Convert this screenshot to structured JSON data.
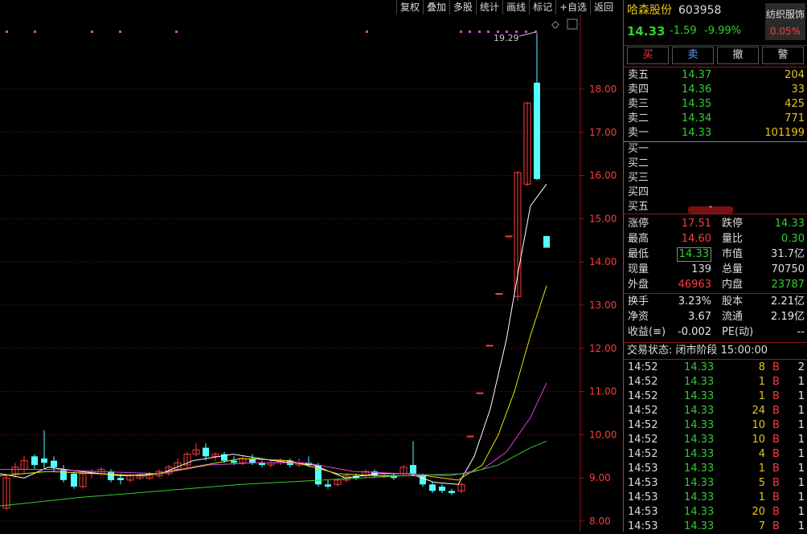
{
  "toolbar": {
    "items": [
      "复权",
      "叠加",
      "多股",
      "统计",
      "画线",
      "标记",
      "+自选",
      "返回"
    ]
  },
  "chart": {
    "price_ticks": [
      "18.00",
      "17.00",
      "16.00",
      "15.00",
      "14.00",
      "13.00",
      "12.00",
      "11.00",
      "10.00",
      "9.00",
      "8.00"
    ],
    "price_values": [
      18,
      17,
      16,
      15,
      14,
      13,
      12,
      11,
      10,
      9,
      8
    ],
    "high_label": "19.29",
    "colors": {
      "up": "#ff3b3b",
      "down": "#54ffff",
      "ma5": "#ffffff",
      "ma10": "#e6e600",
      "ma20": "#e040e0",
      "ma60": "#32cd32",
      "grid": "#8b1a1a"
    }
  },
  "stock": {
    "name": "哈森股份",
    "code": "603958",
    "price": "14.33",
    "change": "-1.59",
    "pct": "-9.99%",
    "sector": "纺织服饰",
    "sector_pct": "0.05%"
  },
  "trade_buttons": [
    "买",
    "卖",
    "撤",
    "警"
  ],
  "sell_orders": [
    {
      "label": "卖五",
      "price": "14.37",
      "vol": "204"
    },
    {
      "label": "卖四",
      "price": "14.36",
      "vol": "33"
    },
    {
      "label": "卖三",
      "price": "14.35",
      "vol": "425"
    },
    {
      "label": "卖二",
      "price": "14.34",
      "vol": "771"
    },
    {
      "label": "卖一",
      "price": "14.33",
      "vol": "101199"
    }
  ],
  "buy_orders": [
    {
      "label": "买一"
    },
    {
      "label": "买二"
    },
    {
      "label": "买三"
    },
    {
      "label": "买四"
    },
    {
      "label": "买五"
    }
  ],
  "stats1": [
    {
      "l1": "涨停",
      "v1": "17.51",
      "l2": "跌停",
      "v2": "14.33"
    },
    {
      "l1": "最高",
      "v1": "14.60",
      "l2": "量比",
      "v2": "0.30"
    },
    {
      "l1": "最低",
      "v1": "14.33",
      "l2": "市值",
      "v2": "31.7亿"
    },
    {
      "l1": "现量",
      "v1": "139",
      "l2": "总量",
      "v2": "70750"
    },
    {
      "l1": "外盘",
      "v1": "46963",
      "l2": "内盘",
      "v2": "23787"
    }
  ],
  "stats2": [
    {
      "l1": "换手",
      "v1": "3.23%",
      "l2": "股本",
      "v2": "2.21亿"
    },
    {
      "l1": "净资",
      "v1": "3.67",
      "l2": "流通",
      "v2": "2.19亿"
    },
    {
      "l1": "收益(≡)",
      "v1": "-0.002",
      "l2": "PE(动)",
      "v2": "--"
    }
  ],
  "trade_status": "交易状态: 闭市阶段 15:00:00",
  "ticks": [
    {
      "t": "14:52",
      "p": "14.33",
      "v": "8",
      "s": "B",
      "n": "2"
    },
    {
      "t": "14:52",
      "p": "14.33",
      "v": "1",
      "s": "B",
      "n": "1"
    },
    {
      "t": "14:52",
      "p": "14.33",
      "v": "1",
      "s": "B",
      "n": "1"
    },
    {
      "t": "14:52",
      "p": "14.33",
      "v": "24",
      "s": "B",
      "n": "1"
    },
    {
      "t": "14:52",
      "p": "14.33",
      "v": "10",
      "s": "B",
      "n": "1"
    },
    {
      "t": "14:52",
      "p": "14.33",
      "v": "10",
      "s": "B",
      "n": "1"
    },
    {
      "t": "14:52",
      "p": "14.33",
      "v": "4",
      "s": "B",
      "n": "1"
    },
    {
      "t": "14:53",
      "p": "14.33",
      "v": "1",
      "s": "B",
      "n": "1"
    },
    {
      "t": "14:53",
      "p": "14.33",
      "v": "5",
      "s": "B",
      "n": "1"
    },
    {
      "t": "14:53",
      "p": "14.33",
      "v": "1",
      "s": "B",
      "n": "1"
    },
    {
      "t": "14:53",
      "p": "14.33",
      "v": "20",
      "s": "B",
      "n": "1"
    },
    {
      "t": "14:53",
      "p": "14.33",
      "v": "7",
      "s": "B",
      "n": "1"
    }
  ]
}
